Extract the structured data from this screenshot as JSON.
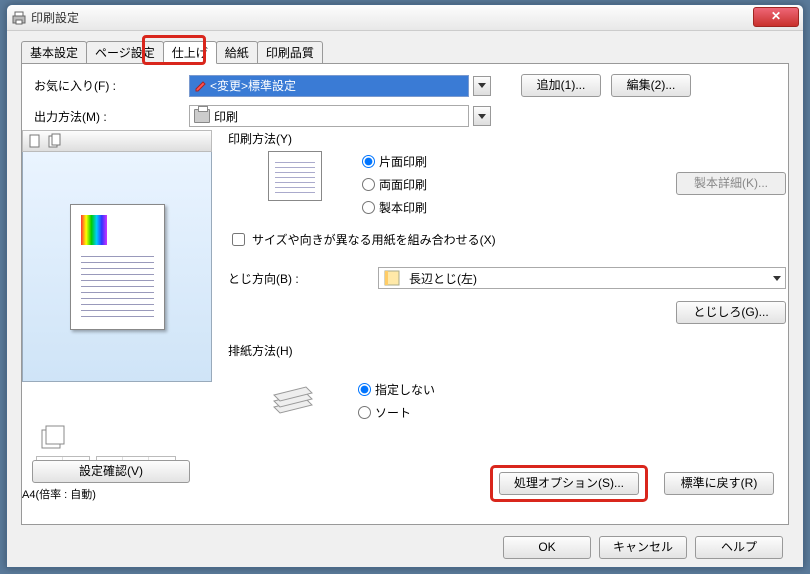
{
  "window": {
    "title": "印刷設定"
  },
  "tabs": {
    "t1": "基本設定",
    "t2": "ページ設定",
    "t3": "仕上げ",
    "t4": "給紙",
    "t5": "印刷品質"
  },
  "favorite": {
    "label": "お気に入り(F) :",
    "value": "<変更>標準設定",
    "add": "追加(1)...",
    "edit": "編集(2)..."
  },
  "output_method": {
    "label": "出力方法(M) :",
    "value": "印刷"
  },
  "preview": {
    "size_text": "A4(倍率 : 自動)"
  },
  "confirm": "設定確認(V)",
  "print_method": {
    "label": "印刷方法(Y)",
    "opts": {
      "single": "片面印刷",
      "duplex": "両面印刷",
      "booklet": "製本印刷"
    },
    "detail": "製本詳細(K)..."
  },
  "mix_check": "サイズや向きが異なる用紙を組み合わせる(X)",
  "binding": {
    "label": "とじ方向(B) :",
    "value": "長辺とじ(左)",
    "gutter": "とじしろ(G)..."
  },
  "output": {
    "label": "排紙方法(H)",
    "opts": {
      "none": "指定しない",
      "sort": "ソート"
    }
  },
  "bottom": {
    "process": "処理オプション(S)...",
    "reset": "標準に戻す(R)"
  },
  "footer": {
    "ok": "OK",
    "cancel": "キャンセル",
    "help": "ヘルプ"
  }
}
